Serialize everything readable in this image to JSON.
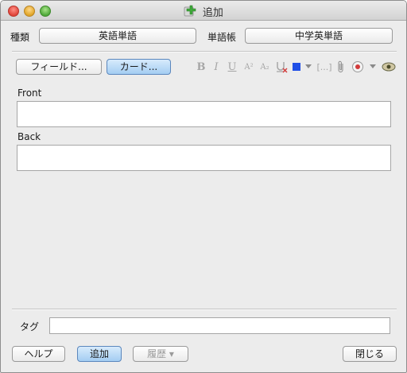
{
  "window": {
    "title": "追加"
  },
  "top": {
    "type_label": "種類",
    "type_value": "英語単語",
    "deck_label": "単語帳",
    "deck_value": "中学英単語"
  },
  "toolbar": {
    "fields_button": "フィールド...",
    "cards_button": "カード...",
    "bold": "B",
    "italic": "I",
    "underline": "U",
    "superscript": "A²",
    "subscript": "A₂",
    "cloze": "[...]",
    "text_color": "#1f4ee6"
  },
  "fields": [
    {
      "label": "Front",
      "value": ""
    },
    {
      "label": "Back",
      "value": ""
    }
  ],
  "tags": {
    "label": "タグ",
    "value": ""
  },
  "bottom": {
    "help_button": "ヘルプ",
    "add_button": "追加",
    "history_button": "履歴 ▾",
    "close_button": "閉じる"
  }
}
